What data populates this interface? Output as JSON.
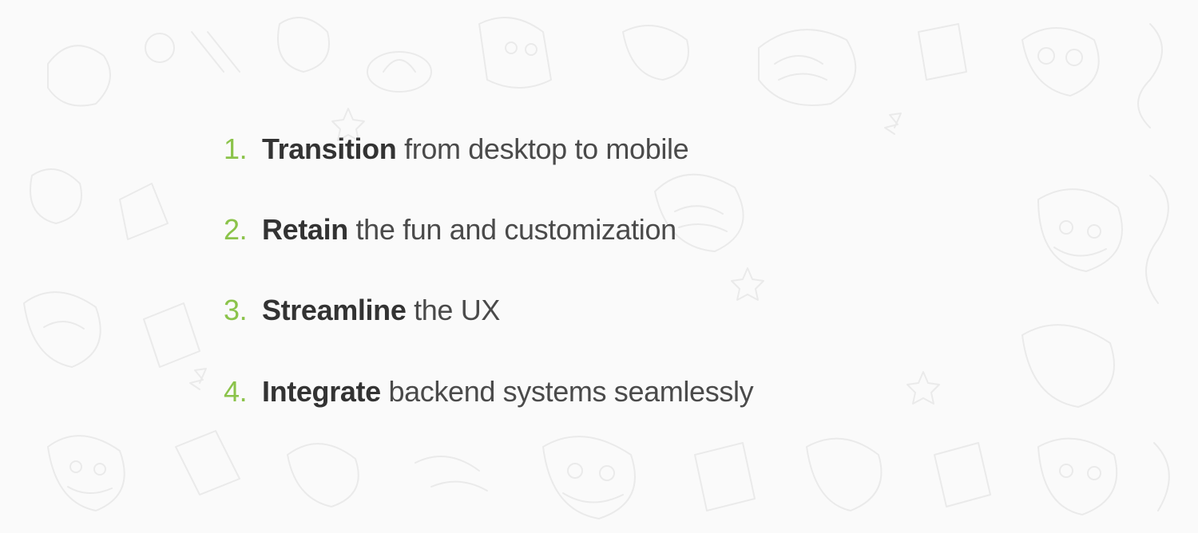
{
  "colors": {
    "accent": "#8bc34a",
    "text": "#4a4a4a",
    "bold": "#333333",
    "background": "#fafafa"
  },
  "items": [
    {
      "num": "1.",
      "bold": "Transition",
      "rest": " from desktop to mobile"
    },
    {
      "num": "2.",
      "bold": "Retain",
      "rest": " the fun and customization"
    },
    {
      "num": "3.",
      "bold": "Streamline",
      "rest": " the UX"
    },
    {
      "num": "4.",
      "bold": "Integrate",
      "rest": " backend systems seamlessly"
    }
  ]
}
